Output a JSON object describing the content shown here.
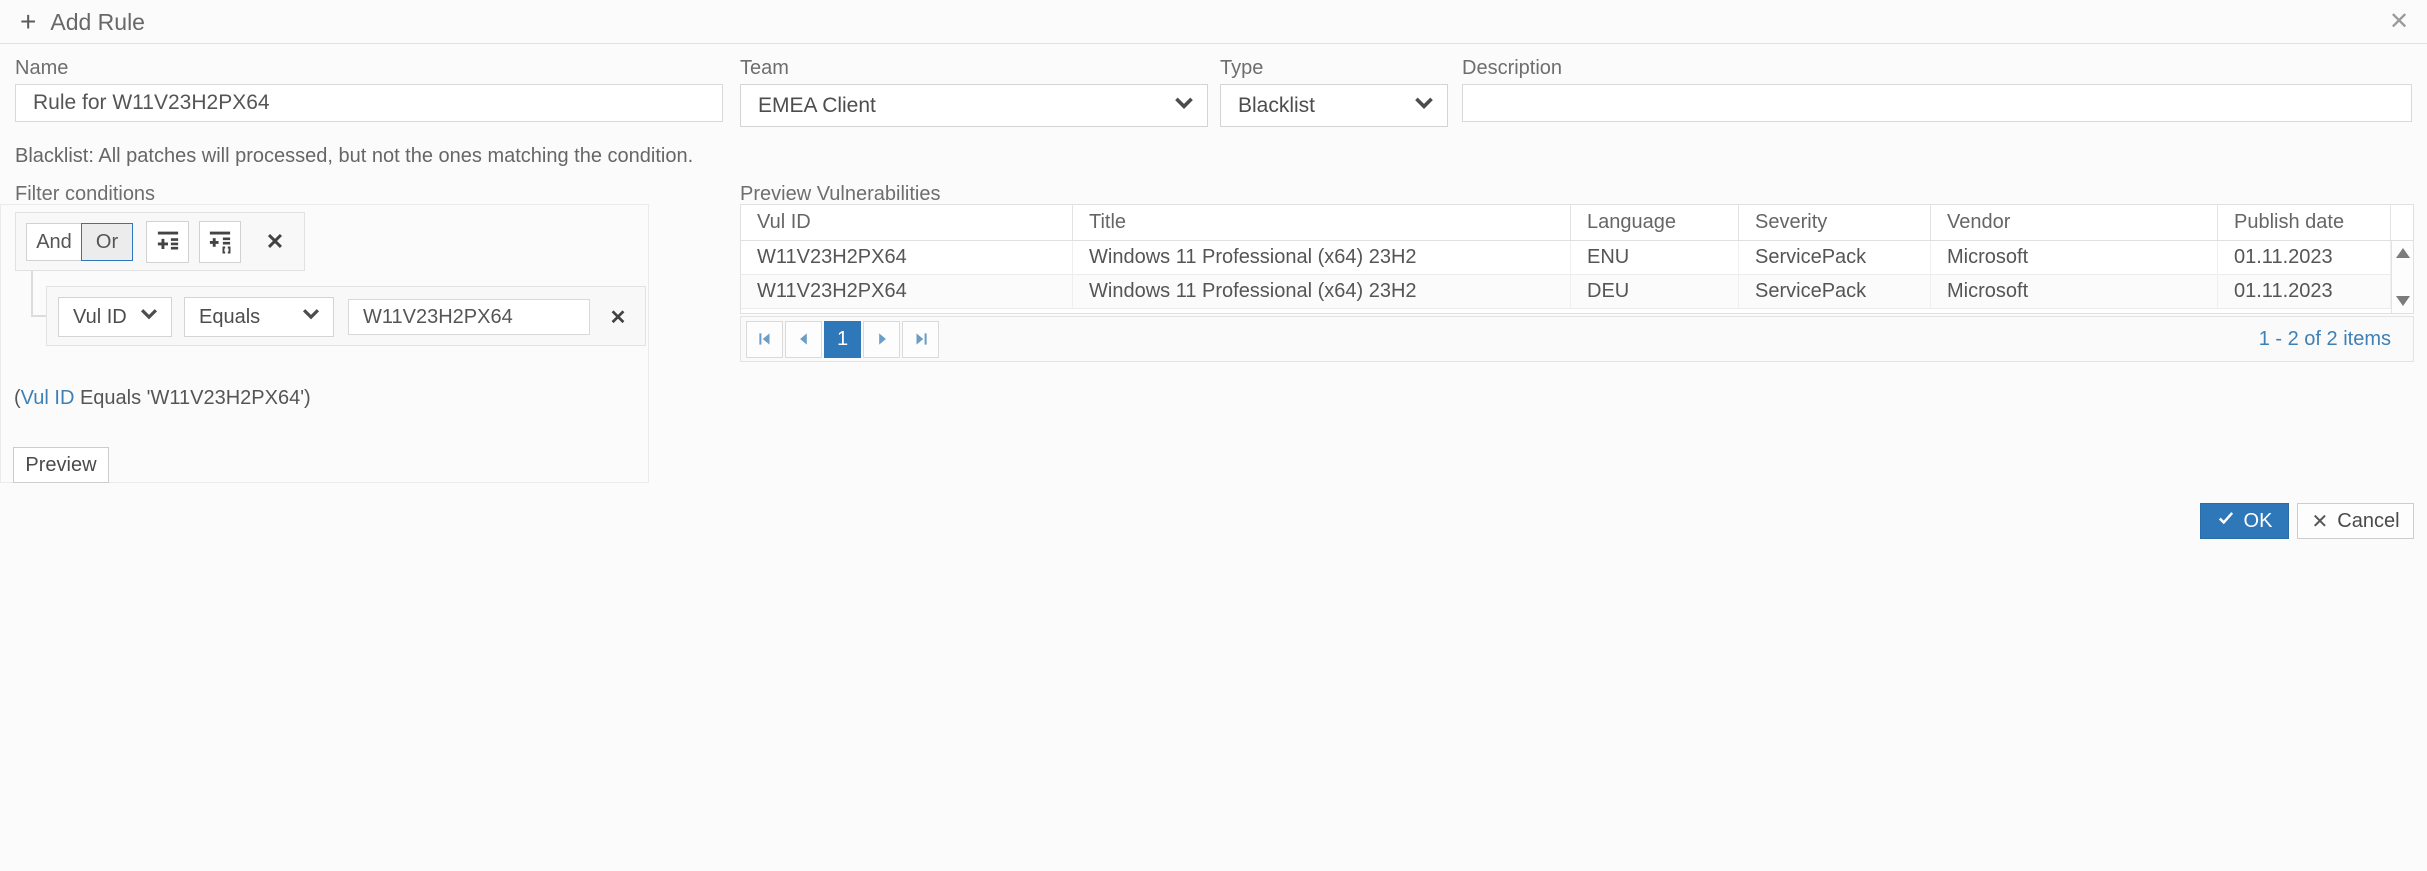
{
  "header": {
    "title": "Add Rule"
  },
  "form": {
    "name": {
      "label": "Name",
      "value": "Rule for W11V23H2PX64"
    },
    "team": {
      "label": "Team",
      "value": "EMEA Client"
    },
    "type": {
      "label": "Type",
      "value": "Blacklist"
    },
    "description": {
      "label": "Description",
      "value": ""
    }
  },
  "note": "Blacklist: All patches will processed, but not the ones matching the condition.",
  "filter": {
    "label": "Filter conditions",
    "and_label": "And",
    "or_label": "Or",
    "selected_logic": "Or",
    "condition": {
      "field": "Vul ID",
      "operator": "Equals",
      "value": "W11V23H2PX64"
    },
    "summary_prefix": "(",
    "summary_field": "Vul ID",
    "summary_rest": " Equals 'W11V23H2PX64')",
    "preview_button": "Preview"
  },
  "grid": {
    "label": "Preview Vulnerabilities",
    "columns": [
      "Vul ID",
      "Title",
      "Language",
      "Severity",
      "Vendor",
      "Publish date"
    ],
    "rows": [
      [
        "W11V23H2PX64",
        "Windows 11 Professional (x64) 23H2",
        "ENU",
        "ServicePack",
        "Microsoft",
        "01.11.2023"
      ],
      [
        "W11V23H2PX64",
        "Windows 11 Professional (x64) 23H2",
        "DEU",
        "ServicePack",
        "Microsoft",
        "01.11.2023"
      ]
    ],
    "pager": {
      "page": "1",
      "items_text": "1 - 2 of 2 items"
    }
  },
  "actions": {
    "ok": "OK",
    "cancel": "Cancel"
  },
  "colors": {
    "accent": "#2e77b8",
    "link": "#3e80b6"
  }
}
